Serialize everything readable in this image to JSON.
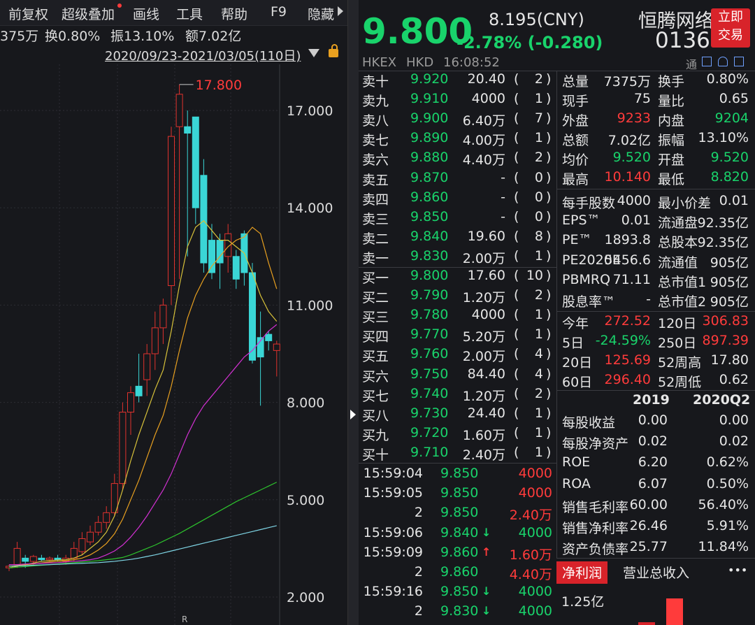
{
  "menu": [
    "前复权",
    "超级叠加",
    "画线",
    "工具",
    "帮助",
    "F9",
    "隐藏"
  ],
  "stats_line": {
    "vol_frag": "375万",
    "turnover": "换0.80%",
    "amplitude": "振13.10%",
    "amount": "额7.02亿"
  },
  "date_range": "2020/09/23-2021/03/05(110日)",
  "chart_data": {
    "type": "candlestick",
    "ylim": [
      2.0,
      18.5
    ],
    "yticks": [
      "17.000",
      "14.000",
      "11.000",
      "8.000",
      "5.000",
      "2.000"
    ],
    "high_annotation": "17.800",
    "x_marker": "R",
    "candles": [
      {
        "o": 2.9,
        "c": 2.95,
        "h": 3.0,
        "l": 2.8
      },
      {
        "o": 3.0,
        "c": 3.5,
        "h": 3.7,
        "l": 2.9
      },
      {
        "o": 3.2,
        "c": 3.1,
        "h": 3.3,
        "l": 2.9
      },
      {
        "o": 3.1,
        "c": 3.25,
        "h": 3.3,
        "l": 3.0
      },
      {
        "o": 3.2,
        "c": 3.15,
        "h": 3.3,
        "l": 3.1
      },
      {
        "o": 3.15,
        "c": 3.2,
        "h": 3.25,
        "l": 3.1
      },
      {
        "o": 3.2,
        "c": 3.15,
        "h": 3.3,
        "l": 3.1
      },
      {
        "o": 3.1,
        "c": 3.2,
        "h": 3.3,
        "l": 3.0
      },
      {
        "o": 3.2,
        "c": 3.5,
        "h": 3.7,
        "l": 3.1
      },
      {
        "o": 3.4,
        "c": 3.8,
        "h": 4.0,
        "l": 3.3
      },
      {
        "o": 3.7,
        "c": 4.0,
        "h": 4.2,
        "l": 3.6
      },
      {
        "o": 4.0,
        "c": 4.3,
        "h": 4.5,
        "l": 3.9
      },
      {
        "o": 4.3,
        "c": 4.6,
        "h": 4.8,
        "l": 4.1
      },
      {
        "o": 4.6,
        "c": 5.5,
        "h": 5.8,
        "l": 4.5
      },
      {
        "o": 5.5,
        "c": 7.7,
        "h": 8.0,
        "l": 5.3
      },
      {
        "o": 7.7,
        "c": 8.3,
        "h": 8.5,
        "l": 7.0
      },
      {
        "o": 8.5,
        "c": 8.2,
        "h": 9.5,
        "l": 8.0
      },
      {
        "o": 8.7,
        "c": 9.5,
        "h": 9.8,
        "l": 8.2
      },
      {
        "o": 9.5,
        "c": 10.3,
        "h": 10.8,
        "l": 9.0
      },
      {
        "o": 10.3,
        "c": 11.0,
        "h": 11.2,
        "l": 9.8
      },
      {
        "o": 11.6,
        "c": 16.2,
        "h": 16.5,
        "l": 11.0
      },
      {
        "o": 16.5,
        "c": 17.5,
        "h": 17.8,
        "l": 11.8
      },
      {
        "o": 16.5,
        "c": 16.3,
        "h": 17.0,
        "l": 12.5
      },
      {
        "o": 16.8,
        "c": 14.0,
        "h": 16.8,
        "l": 13.5
      },
      {
        "o": 15.0,
        "c": 12.3,
        "h": 15.5,
        "l": 12.0
      },
      {
        "o": 13.0,
        "c": 12.0,
        "h": 13.5,
        "l": 11.8
      },
      {
        "o": 13.0,
        "c": 12.3,
        "h": 13.2,
        "l": 11.5
      },
      {
        "o": 12.5,
        "c": 13.2,
        "h": 13.5,
        "l": 12.0
      },
      {
        "o": 12.5,
        "c": 11.8,
        "h": 12.7,
        "l": 11.5
      },
      {
        "o": 13.2,
        "c": 12.0,
        "h": 13.3,
        "l": 11.6
      },
      {
        "o": 12.0,
        "c": 9.3,
        "h": 12.3,
        "l": 9.2
      },
      {
        "o": 10.0,
        "c": 9.4,
        "h": 10.8,
        "l": 7.9
      },
      {
        "o": 10.1,
        "c": 9.9,
        "h": 10.2,
        "l": 9.6
      },
      {
        "o": 9.6,
        "c": 9.8,
        "h": 9.9,
        "l": 8.8
      }
    ],
    "ma": [
      {
        "color": "#d8c23a",
        "values": [
          2.9,
          2.95,
          3.0,
          3.05,
          3.1,
          3.12,
          3.14,
          3.15,
          3.2,
          3.3,
          3.5,
          3.7,
          4.0,
          4.5,
          5.3,
          6.2,
          7.0,
          7.7,
          8.4,
          9.0,
          10.2,
          11.6,
          12.8,
          13.4,
          13.6,
          13.3,
          13.0,
          13.0,
          12.8,
          12.6,
          12.0,
          11.3,
          10.8,
          10.5
        ]
      },
      {
        "color": "#e8a020",
        "values": [
          2.95,
          2.97,
          3.0,
          3.02,
          3.05,
          3.08,
          3.1,
          3.12,
          3.15,
          3.2,
          3.3,
          3.45,
          3.65,
          3.95,
          4.4,
          5.0,
          5.6,
          6.3,
          7.0,
          7.6,
          8.5,
          9.6,
          10.6,
          11.3,
          11.8,
          12.2,
          12.5,
          12.8,
          13.0,
          13.1,
          13.4,
          13.2,
          12.3,
          11.5
        ]
      },
      {
        "color": "#d230d2",
        "values": [
          3.0,
          3.0,
          3.02,
          3.03,
          3.04,
          3.05,
          3.06,
          3.08,
          3.1,
          3.12,
          3.15,
          3.2,
          3.3,
          3.42,
          3.6,
          3.85,
          4.15,
          4.5,
          4.9,
          5.3,
          5.8,
          6.4,
          7.0,
          7.5,
          7.9,
          8.2,
          8.5,
          8.8,
          9.1,
          9.4,
          9.6,
          9.9,
          10.2,
          10.4
        ]
      },
      {
        "color": "#2dc32d",
        "values": [
          2.9,
          2.92,
          2.94,
          2.96,
          2.98,
          3.0,
          3.02,
          3.04,
          3.06,
          3.08,
          3.1,
          3.12,
          3.15,
          3.18,
          3.22,
          3.3,
          3.4,
          3.5,
          3.6,
          3.72,
          3.84,
          3.96,
          4.1,
          4.24,
          4.38,
          4.52,
          4.66,
          4.8,
          4.94,
          5.06,
          5.18,
          5.3,
          5.42,
          5.54
        ]
      },
      {
        "color": "#7fd6e6",
        "values": [
          2.95,
          2.96,
          2.97,
          2.98,
          2.99,
          3.0,
          3.01,
          3.02,
          3.03,
          3.04,
          3.05,
          3.06,
          3.08,
          3.1,
          3.13,
          3.16,
          3.2,
          3.25,
          3.3,
          3.36,
          3.42,
          3.48,
          3.54,
          3.6,
          3.66,
          3.72,
          3.78,
          3.84,
          3.9,
          3.96,
          4.02,
          4.08,
          4.14,
          4.2
        ]
      }
    ]
  },
  "quote": {
    "price": "9.800",
    "cny": "8.195(CNY)",
    "change": "-2.78% (-0.280)",
    "name": "恒腾网络",
    "code": "0136",
    "trade_btn_1": "立即",
    "trade_btn_2": "交易",
    "exchange": "HKEX",
    "currency": "HKD",
    "time": "16:08:52",
    "tong": "通",
    "up_color": "#ff3b3b",
    "down_color": "#19d36b"
  },
  "sells": [
    {
      "label": "卖十",
      "price": "9.920",
      "vol": "20.40",
      "cnt": "2"
    },
    {
      "label": "卖九",
      "price": "9.910",
      "vol": "4000",
      "cnt": "1"
    },
    {
      "label": "卖八",
      "price": "9.900",
      "vol": "6.40万",
      "cnt": "7"
    },
    {
      "label": "卖七",
      "price": "9.890",
      "vol": "4.00万",
      "cnt": "1"
    },
    {
      "label": "卖六",
      "price": "9.880",
      "vol": "4.40万",
      "cnt": "2"
    },
    {
      "label": "卖五",
      "price": "9.870",
      "vol": "-",
      "cnt": "0"
    },
    {
      "label": "卖四",
      "price": "9.860",
      "vol": "-",
      "cnt": "0"
    },
    {
      "label": "卖三",
      "price": "9.850",
      "vol": "-",
      "cnt": "0"
    },
    {
      "label": "卖二",
      "price": "9.840",
      "vol": "19.60",
      "cnt": "8"
    },
    {
      "label": "卖一",
      "price": "9.830",
      "vol": "2.00万",
      "cnt": "1"
    }
  ],
  "buys": [
    {
      "label": "买一",
      "price": "9.800",
      "vol": "17.60",
      "cnt": "10"
    },
    {
      "label": "买二",
      "price": "9.790",
      "vol": "1.20万",
      "cnt": "2"
    },
    {
      "label": "买三",
      "price": "9.780",
      "vol": "4000",
      "cnt": "1"
    },
    {
      "label": "买四",
      "price": "9.770",
      "vol": "5.20万",
      "cnt": "1"
    },
    {
      "label": "买五",
      "price": "9.760",
      "vol": "2.00万",
      "cnt": "4"
    },
    {
      "label": "买六",
      "price": "9.750",
      "vol": "84.40",
      "cnt": "4"
    },
    {
      "label": "买七",
      "price": "9.740",
      "vol": "1.20万",
      "cnt": "2"
    },
    {
      "label": "买八",
      "price": "9.730",
      "vol": "24.40",
      "cnt": "1"
    },
    {
      "label": "买九",
      "price": "9.720",
      "vol": "1.60万",
      "cnt": "1"
    },
    {
      "label": "买十",
      "price": "9.710",
      "vol": "2.40万",
      "cnt": "1"
    }
  ],
  "ticks": [
    {
      "time": "15:59:04",
      "price": "9.850",
      "arrow": "",
      "vol": "4000",
      "vcolor": "red"
    },
    {
      "time": "15:59:05",
      "price": "9.850",
      "arrow": "",
      "vol": "4000",
      "vcolor": "red"
    },
    {
      "time": "2",
      "price": "9.850",
      "arrow": "",
      "vol": "2.40万",
      "vcolor": "red"
    },
    {
      "time": "15:59:06",
      "price": "9.840",
      "arrow": "↓",
      "vol": "4000",
      "vcolor": "green"
    },
    {
      "time": "15:59:09",
      "price": "9.860",
      "arrow": "↑",
      "vol": "1.60万",
      "vcolor": "red"
    },
    {
      "time": "2",
      "price": "9.860",
      "arrow": "",
      "vol": "4.40万",
      "vcolor": "red"
    },
    {
      "time": "15:59:16",
      "price": "9.850",
      "arrow": "↓",
      "vol": "4000",
      "vcolor": "green"
    },
    {
      "time": "2",
      "price": "9.830",
      "arrow": "↓",
      "vol": "4000",
      "vcolor": "green"
    }
  ],
  "stats": [
    [
      {
        "k": "总量",
        "v": "7375万",
        "c": "white"
      },
      {
        "k": "换手",
        "v": "0.80%",
        "c": "white"
      }
    ],
    [
      {
        "k": "现手",
        "v": "75",
        "c": "white"
      },
      {
        "k": "量比",
        "v": "0.65",
        "c": "white"
      }
    ],
    [
      {
        "k": "外盘",
        "v": "9233",
        "c": "red"
      },
      {
        "k": "内盘",
        "v": "9204",
        "c": "green"
      }
    ],
    [
      {
        "k": "总额",
        "v": "7.02亿",
        "c": "white"
      },
      {
        "k": "振幅",
        "v": "13.10%",
        "c": "white"
      }
    ],
    [
      {
        "k": "均价",
        "v": "9.520",
        "c": "green"
      },
      {
        "k": "开盘",
        "v": "9.520",
        "c": "green"
      }
    ],
    [
      {
        "k": "最高",
        "v": "10.140",
        "c": "red"
      },
      {
        "k": "最低",
        "v": "8.820",
        "c": "green"
      }
    ]
  ],
  "stats2": [
    [
      {
        "k": "每手股数",
        "v": "4000",
        "c": "white"
      },
      {
        "k": "最小价差",
        "v": "0.01",
        "c": "white"
      }
    ],
    [
      {
        "k": "EPS™",
        "v": "0.01",
        "c": "white"
      },
      {
        "k": "流通盘",
        "v": "92.35亿",
        "c": "white"
      }
    ],
    [
      {
        "k": "PE™",
        "v": "1893.8",
        "c": "white"
      },
      {
        "k": "总股本",
        "v": "92.35亿",
        "c": "white"
      }
    ],
    [
      {
        "k": "PE2020E",
        "v": "5456.6",
        "c": "white"
      },
      {
        "k": "流通值",
        "v": "905亿",
        "c": "white"
      }
    ],
    [
      {
        "k": "PBMRQ",
        "v": "71.11",
        "c": "white"
      },
      {
        "k": "总市值1",
        "v": "905亿",
        "c": "white"
      }
    ],
    [
      {
        "k": "股息率™",
        "v": "-",
        "c": "white"
      },
      {
        "k": "总市值2",
        "v": "905亿",
        "c": "white"
      }
    ]
  ],
  "perf": [
    [
      {
        "k": "今年",
        "v": "272.52",
        "c": "red"
      },
      {
        "k": "120日",
        "v": "306.83",
        "c": "red"
      }
    ],
    [
      {
        "k": "5日",
        "v": "-24.59%",
        "c": "green"
      },
      {
        "k": "250日",
        "v": "897.39",
        "c": "red"
      }
    ],
    [
      {
        "k": "20日",
        "v": "125.69",
        "c": "red"
      },
      {
        "k": "52周高",
        "v": "17.80",
        "c": "white"
      }
    ],
    [
      {
        "k": "60日",
        "v": "296.40",
        "c": "red"
      },
      {
        "k": "52周低",
        "v": "0.62",
        "c": "white"
      }
    ]
  ],
  "fin_header": [
    "2019",
    "2020Q2"
  ],
  "fin": [
    {
      "k": "每股收益",
      "a": "0.00",
      "b": "0.00"
    },
    {
      "k": "每股净资产",
      "a": "0.02",
      "b": "0.02"
    },
    {
      "k": "ROE",
      "a": "6.20",
      "b": "0.62%"
    },
    {
      "k": "ROA",
      "a": "6.07",
      "b": "0.50%"
    },
    {
      "k": "销售毛利率",
      "a": "60.00",
      "b": "56.40%"
    },
    {
      "k": "销售净利率",
      "a": "26.46",
      "b": "5.91%"
    },
    {
      "k": "资产负债率",
      "a": "25.77",
      "b": "11.84%"
    }
  ],
  "tabs": [
    "净利润",
    "营业总收入"
  ],
  "mini_chart_label": "1.25亿",
  "more": "•••"
}
